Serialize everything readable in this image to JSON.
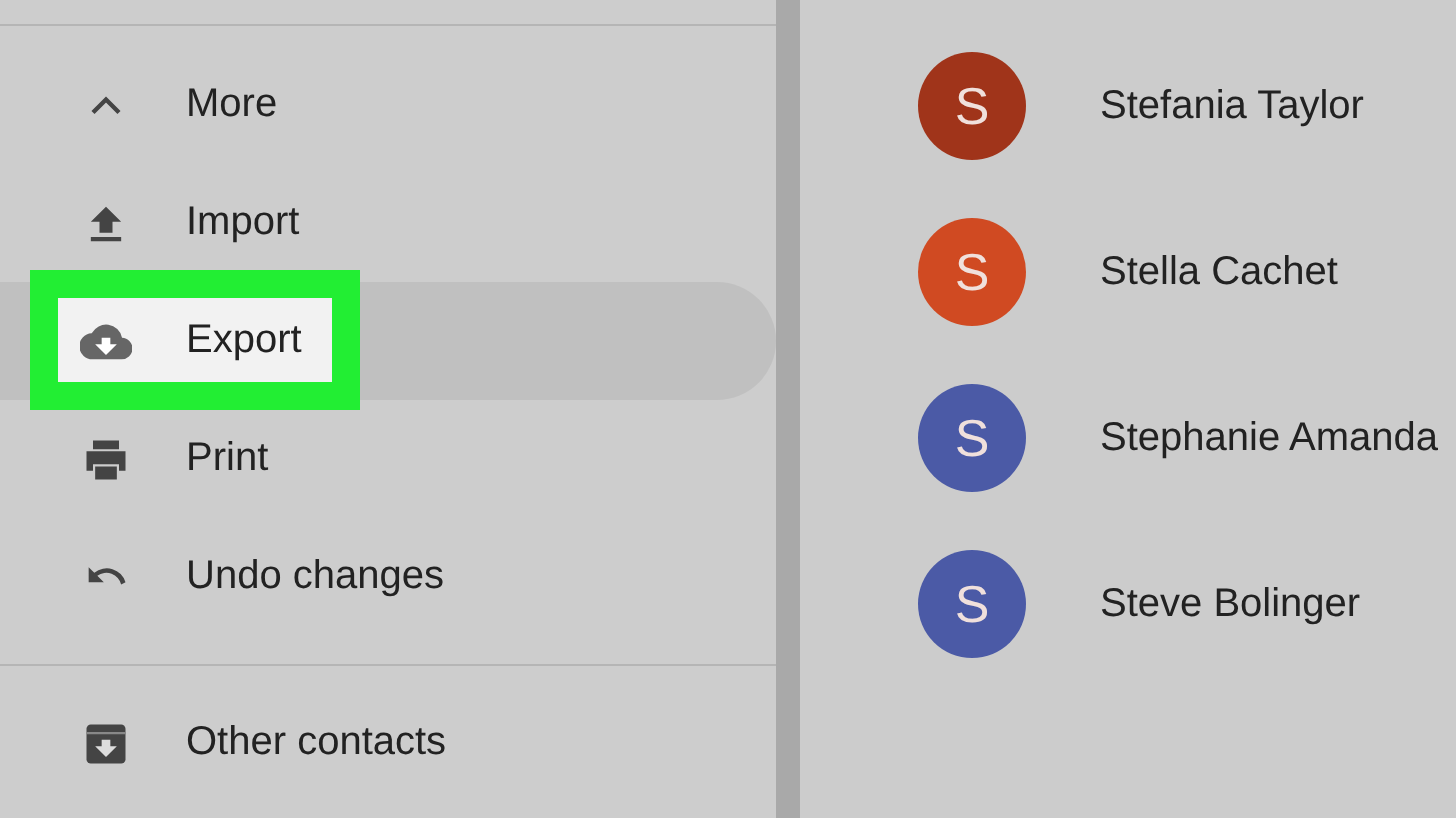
{
  "sidebar": {
    "groups": [
      {
        "items": [
          {
            "label": "More",
            "kind": "caret-up",
            "selected": false,
            "highlighted": false
          },
          {
            "label": "Import",
            "kind": "upload",
            "selected": false,
            "highlighted": false
          },
          {
            "label": "Export",
            "kind": "cloud-download",
            "selected": true,
            "highlighted": true
          },
          {
            "label": "Print",
            "kind": "printer",
            "selected": false,
            "highlighted": false
          },
          {
            "label": "Undo changes",
            "kind": "undo",
            "selected": false,
            "highlighted": false
          }
        ]
      },
      {
        "items": [
          {
            "label": "Other contacts",
            "kind": "archive",
            "selected": false,
            "highlighted": false
          }
        ]
      }
    ]
  },
  "contacts": [
    {
      "initial": "S",
      "name": "Stefania Taylor",
      "color": "#a0341a"
    },
    {
      "initial": "S",
      "name": "Stella Cachet",
      "color": "#d04a22"
    },
    {
      "initial": "S",
      "name": "Stephanie Amanda",
      "color": "#4b5aa6"
    },
    {
      "initial": "S",
      "name": "Steve Bolinger",
      "color": "#4b5aa6"
    }
  ]
}
